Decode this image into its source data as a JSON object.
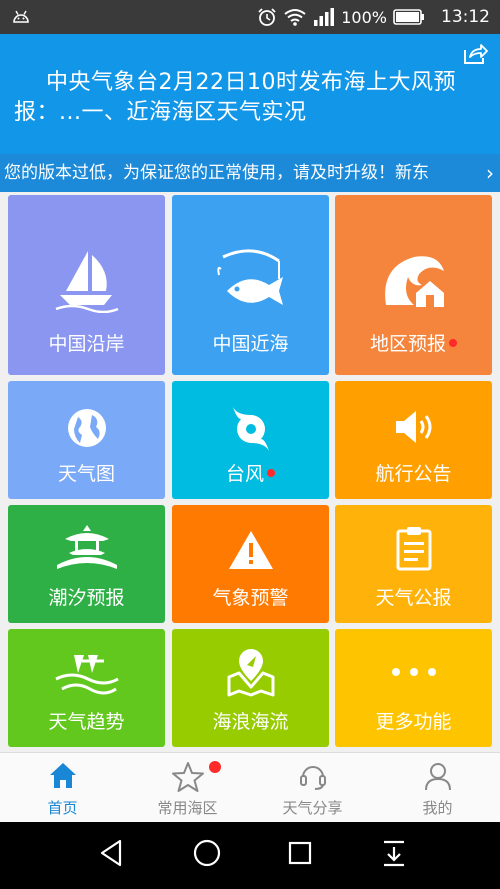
{
  "status_bar": {
    "battery_pct": "100%",
    "time": "13:12",
    "icons": [
      "android-icon",
      "alarm-icon",
      "wifi-icon",
      "signal-icon",
      "battery-icon"
    ]
  },
  "banner": {
    "headline": "中央气象台2月22日10时发布海上大风预报：...一、近海海区天气实况",
    "share_icon": "share-icon"
  },
  "notice": {
    "text": "您的版本过低，为保证您的正常使用，请及时升级！新东"
  },
  "tiles": [
    {
      "label": "中国沿岸",
      "icon": "sailboat-icon",
      "color": "#8a96f0",
      "badge": false
    },
    {
      "label": "中国近海",
      "icon": "fish-icon",
      "color": "#3ba1f0",
      "badge": false
    },
    {
      "label": "地区预报",
      "icon": "wave-house-icon",
      "color": "#f5843c",
      "badge": true
    },
    {
      "label": "天气图",
      "icon": "globe-icon",
      "color": "#7aa9f7",
      "badge": false
    },
    {
      "label": "台风",
      "icon": "typhoon-icon",
      "color": "#00bce0",
      "badge": true
    },
    {
      "label": "航行公告",
      "icon": "speaker-icon",
      "color": "#ffa000",
      "badge": false
    },
    {
      "label": "潮汐预报",
      "icon": "pavilion-icon",
      "color": "#2fb047",
      "badge": false
    },
    {
      "label": "气象预警",
      "icon": "warning-icon",
      "color": "#ff7a00",
      "badge": false
    },
    {
      "label": "天气公报",
      "icon": "clipboard-icon",
      "color": "#ffb20a",
      "badge": false
    },
    {
      "label": "天气趋势",
      "icon": "trend-wave-icon",
      "color": "#62c81e",
      "badge": false
    },
    {
      "label": "海浪海流",
      "icon": "map-pin-icon",
      "color": "#96cc00",
      "badge": false
    },
    {
      "label": "更多功能",
      "icon": "more-dots-icon",
      "color": "#ffc400",
      "badge": false
    }
  ],
  "tabs": [
    {
      "label": "首页",
      "icon": "home-icon",
      "active": true
    },
    {
      "label": "常用海区",
      "icon": "star-icon",
      "badge": true
    },
    {
      "label": "天气分享",
      "icon": "headset-icon"
    },
    {
      "label": "我的",
      "icon": "person-icon"
    }
  ],
  "nav_bar": [
    "back-icon",
    "home-circle-icon",
    "recents-icon",
    "notification-pull-icon"
  ]
}
